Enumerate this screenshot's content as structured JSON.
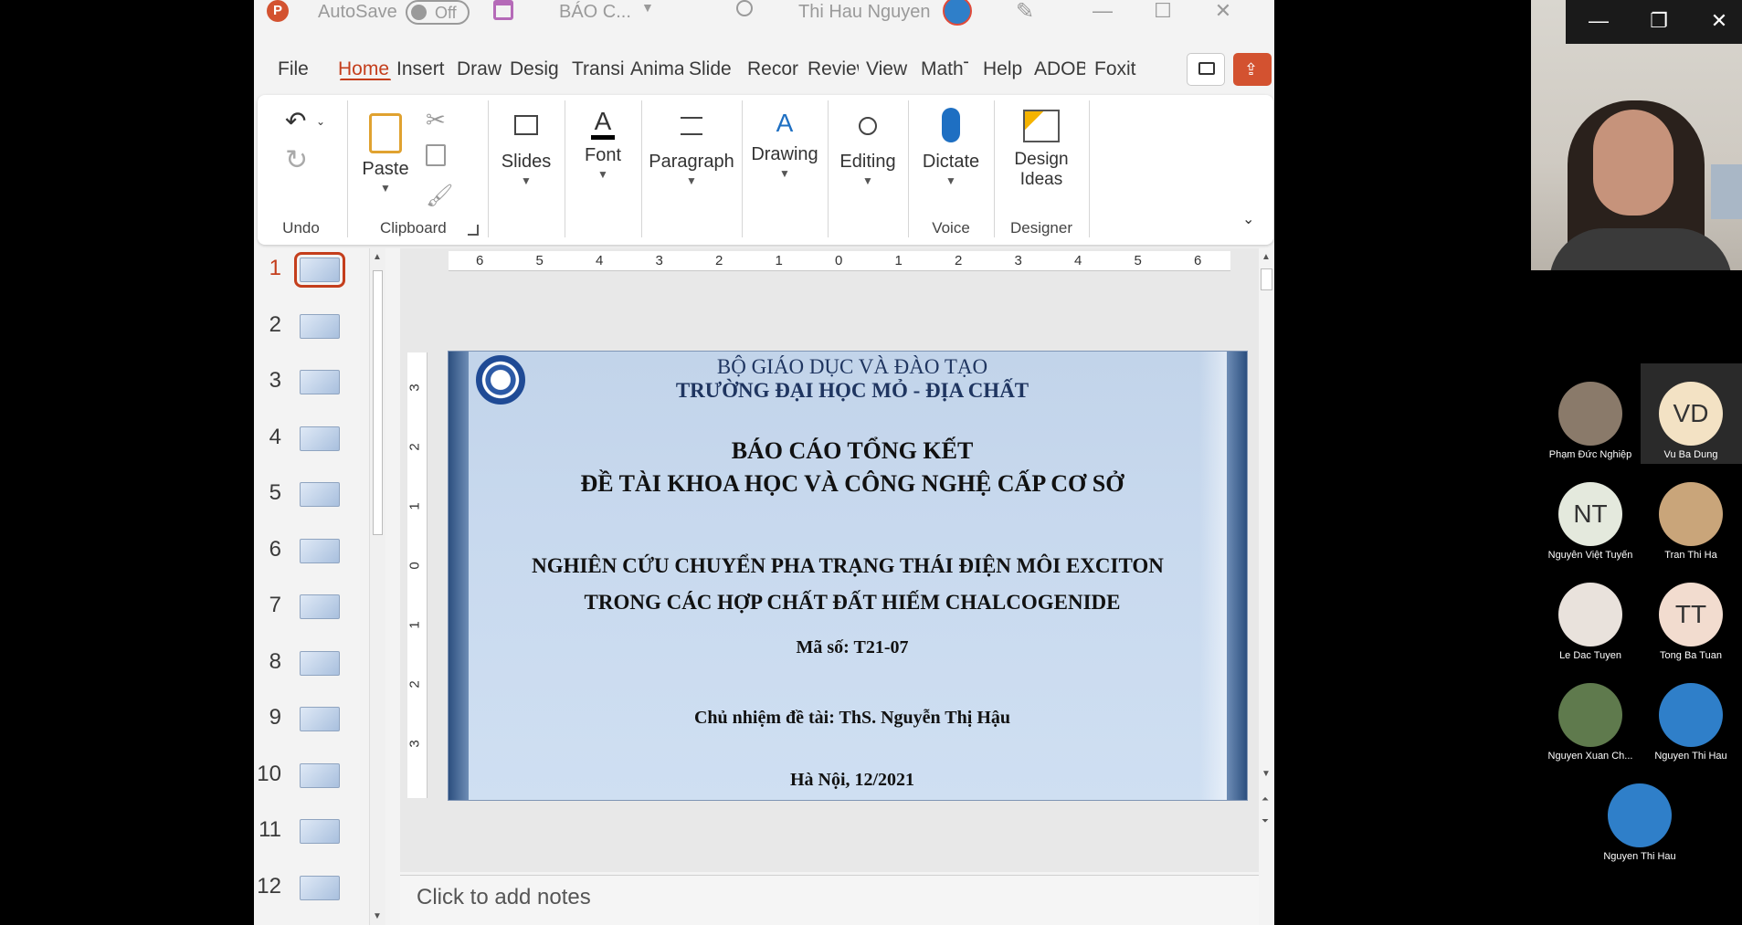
{
  "titlebar": {
    "autosave_label": "AutoSave",
    "autosave_state": "Off",
    "file_name": "BÁO C...",
    "user_name": "Thi Hau Nguyen"
  },
  "tabs": [
    "File",
    "Home",
    "Insert",
    "Draw",
    "Desig",
    "Transi",
    "Anima",
    "Slide",
    "Recor",
    "Review",
    "View",
    "MathT",
    "Help",
    "ADOBE",
    "Foxit"
  ],
  "active_tab": "Home",
  "ribbon": {
    "undo_label": "Undo",
    "paste_label": "Paste",
    "clipboard_label": "Clipboard",
    "slides_label": "Slides",
    "font_label": "Font",
    "paragraph_label": "Paragraph",
    "drawing_label": "Drawing",
    "editing_label": "Editing",
    "dictate_label": "Dictate",
    "voice_label": "Voice",
    "design_ideas_line1": "Design",
    "design_ideas_line2": "Ideas",
    "designer_label": "Designer"
  },
  "thumbnails": [
    "1",
    "2",
    "3",
    "4",
    "5",
    "6",
    "7",
    "8",
    "9",
    "10",
    "11",
    "12"
  ],
  "active_slide": "1",
  "hruler_ticks": [
    "6",
    "5",
    "4",
    "3",
    "2",
    "1",
    "0",
    "1",
    "2",
    "3",
    "4",
    "5",
    "6"
  ],
  "vruler_ticks": [
    "3",
    "2",
    "1",
    "0",
    "1",
    "2",
    "3"
  ],
  "slide": {
    "ministry": "BỘ GIÁO DỤC VÀ ĐÀO TẠO",
    "university": "TRƯỜNG ĐẠI HỌC MỎ - ĐỊA CHẤT",
    "report_title": "BÁO CÁO TỔNG KẾT",
    "report_subtitle": "ĐỀ TÀI KHOA HỌC VÀ CÔNG NGHỆ CẤP CƠ SỞ",
    "topic_line1": "NGHIÊN CỨU CHUYỂN PHA TRẠNG THÁI ĐIỆN MÔI EXCITON",
    "topic_line2": "TRONG CÁC HỢP CHẤT ĐẤT HIẾM CHALCOGENIDE",
    "code": "Mã số: T21-07",
    "leader": "Chủ nhiệm đề tài: ThS. Nguyễn Thị Hậu",
    "place_date": "Hà Nội, 12/2021"
  },
  "notes_placeholder": "Click to add notes",
  "participants": [
    {
      "name": "Phạm Đức Nghiệp",
      "initials": "",
      "color": "#8a7a6a"
    },
    {
      "name": "Vu Ba Dung",
      "initials": "VD",
      "color": "#f3e2c4"
    },
    {
      "name": "Nguyễn Việt Tuyến",
      "initials": "NT",
      "color": "#e4e9dd"
    },
    {
      "name": "Tran Thi Ha",
      "initials": "",
      "color": "#c9a57a"
    },
    {
      "name": "Le Dac Tuyen",
      "initials": "",
      "color": "#e9e2dc"
    },
    {
      "name": "Tong Ba Tuan",
      "initials": "TT",
      "color": "#f2dccf"
    },
    {
      "name": "Nguyen Xuan Ch...",
      "initials": "",
      "color": "#5f7a4d"
    },
    {
      "name": "Nguyen Thi Hau",
      "initials": "",
      "color": "#2f7fc9"
    },
    {
      "name": "Nguyen Thi Hau",
      "initials": "",
      "color": "#2f7fc9"
    }
  ]
}
